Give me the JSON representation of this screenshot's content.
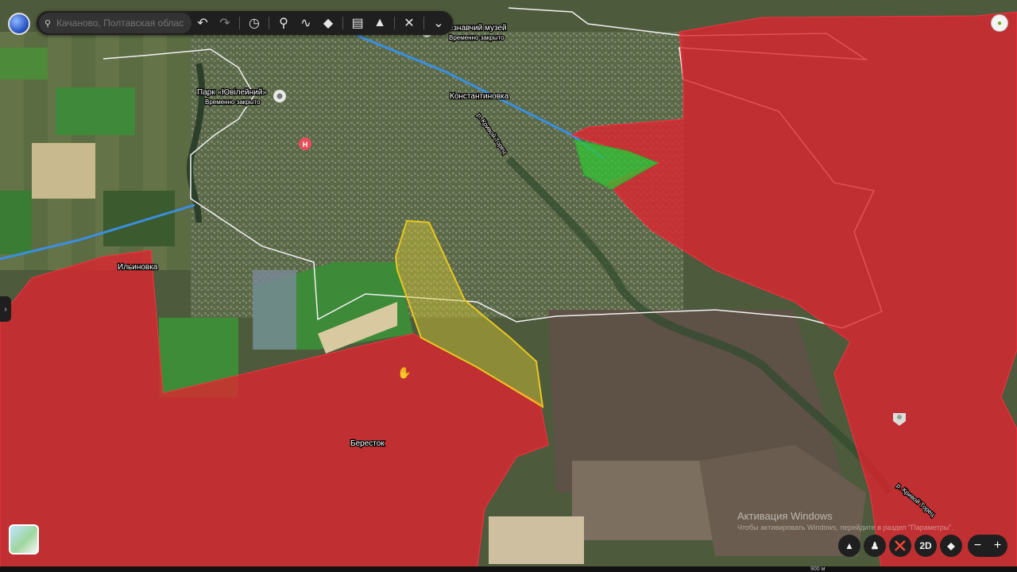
{
  "search": {
    "placeholder": "Качаново, Полтавская область"
  },
  "toolbar": {
    "icons": [
      "search-icon",
      "undo-icon",
      "redo-icon",
      "history-icon",
      "placemark-icon",
      "path-icon",
      "layers-icon",
      "ruler-icon",
      "image-overlay-icon",
      "tools-icon",
      "chevron-down-icon"
    ]
  },
  "places": {
    "museum": "езнавчий музей",
    "museum_status": "Временно закрыто",
    "park": "Парк «Ювілейний»",
    "park_status": "Временно закрыто",
    "city": "Константиновка",
    "village_west": "Ильиновка",
    "village_south": "Бересток",
    "river_1": "р. Кривой Торец",
    "river_2": "р. Кривой Торец"
  },
  "controls": {
    "mode_2d": "2D",
    "zoom_out": "−",
    "zoom_in": "+"
  },
  "watermark": {
    "line1": "Активация Windows",
    "line2": "Чтобы активировать Windows, перейдите в раздел \"Параметры\"."
  },
  "status": {
    "scale": "900 м"
  },
  "colors": {
    "occupied": "#e0222e",
    "liberated": "#33c433",
    "contested": "#e8c820",
    "road": "#3b8fe0"
  }
}
